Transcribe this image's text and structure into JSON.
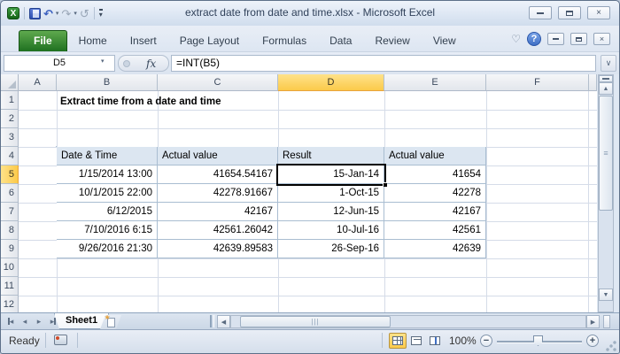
{
  "window": {
    "title": "extract date from date and time.xlsx  -  Microsoft Excel"
  },
  "icons": {
    "undo_glyph": "↶",
    "redo_glyph": "↷",
    "repeat_glyph": "↺",
    "dropdown_glyph": "▾",
    "logo_letter": "X",
    "minimize_ribbon_glyph": "♡",
    "help_glyph": "?",
    "close_glyph": "×",
    "up_arrow": "▲",
    "down_arrow": "▼",
    "left_arrow": "◀",
    "right_arrow": "▶",
    "tab_prev": "◂",
    "tab_next": "▸",
    "grip_glyph": "≡",
    "hgrip_glyph": "|||",
    "star_glyph": "★",
    "chevron_down": "∨"
  },
  "ribbon": {
    "tabs": [
      "File",
      "Home",
      "Insert",
      "Page Layout",
      "Formulas",
      "Data",
      "Review",
      "View"
    ],
    "active_tab": "File"
  },
  "formula_bar": {
    "name_box": "D5",
    "fx_label": "fx",
    "formula": "=INT(B5)"
  },
  "grid": {
    "columns": [
      "A",
      "B",
      "C",
      "D",
      "E",
      "F"
    ],
    "selected_column": "D",
    "rows": [
      "1",
      "2",
      "3",
      "4",
      "5",
      "6",
      "7",
      "8",
      "9",
      "10",
      "11",
      "12"
    ],
    "selected_row": "5",
    "title_cell": "Extract time from a date and time",
    "table": {
      "start_cell": "B4",
      "headers": [
        "Date & Time",
        "Actual value",
        "Result",
        "Actual value"
      ],
      "rows": [
        [
          "1/15/2014 13:00",
          "41654.54167",
          "15-Jan-14",
          "41654"
        ],
        [
          "10/1/2015 22:00",
          "42278.91667",
          "1-Oct-15",
          "42278"
        ],
        [
          "6/12/2015",
          "42167",
          "12-Jun-15",
          "42167"
        ],
        [
          "7/10/2016 6:15",
          "42561.26042",
          "10-Jul-16",
          "42561"
        ],
        [
          "9/26/2016 21:30",
          "42639.89583",
          "26-Sep-16",
          "42639"
        ]
      ]
    },
    "selection": {
      "cell_ref": "D5"
    }
  },
  "sheet_bar": {
    "tabs": [
      "Sheet1"
    ],
    "active_tab": "Sheet1"
  },
  "status_bar": {
    "mode": "Ready",
    "zoom_level": "100%"
  },
  "colors": {
    "file_tab_green": "#1e7020",
    "selected_header_fill": "#fbca4a",
    "table_header_fill": "#dce6f1",
    "table_border": "#a9bdd1",
    "gridline": "#d5dce8",
    "selection_border": "#000000",
    "help_blue": "#3f6fc4"
  }
}
